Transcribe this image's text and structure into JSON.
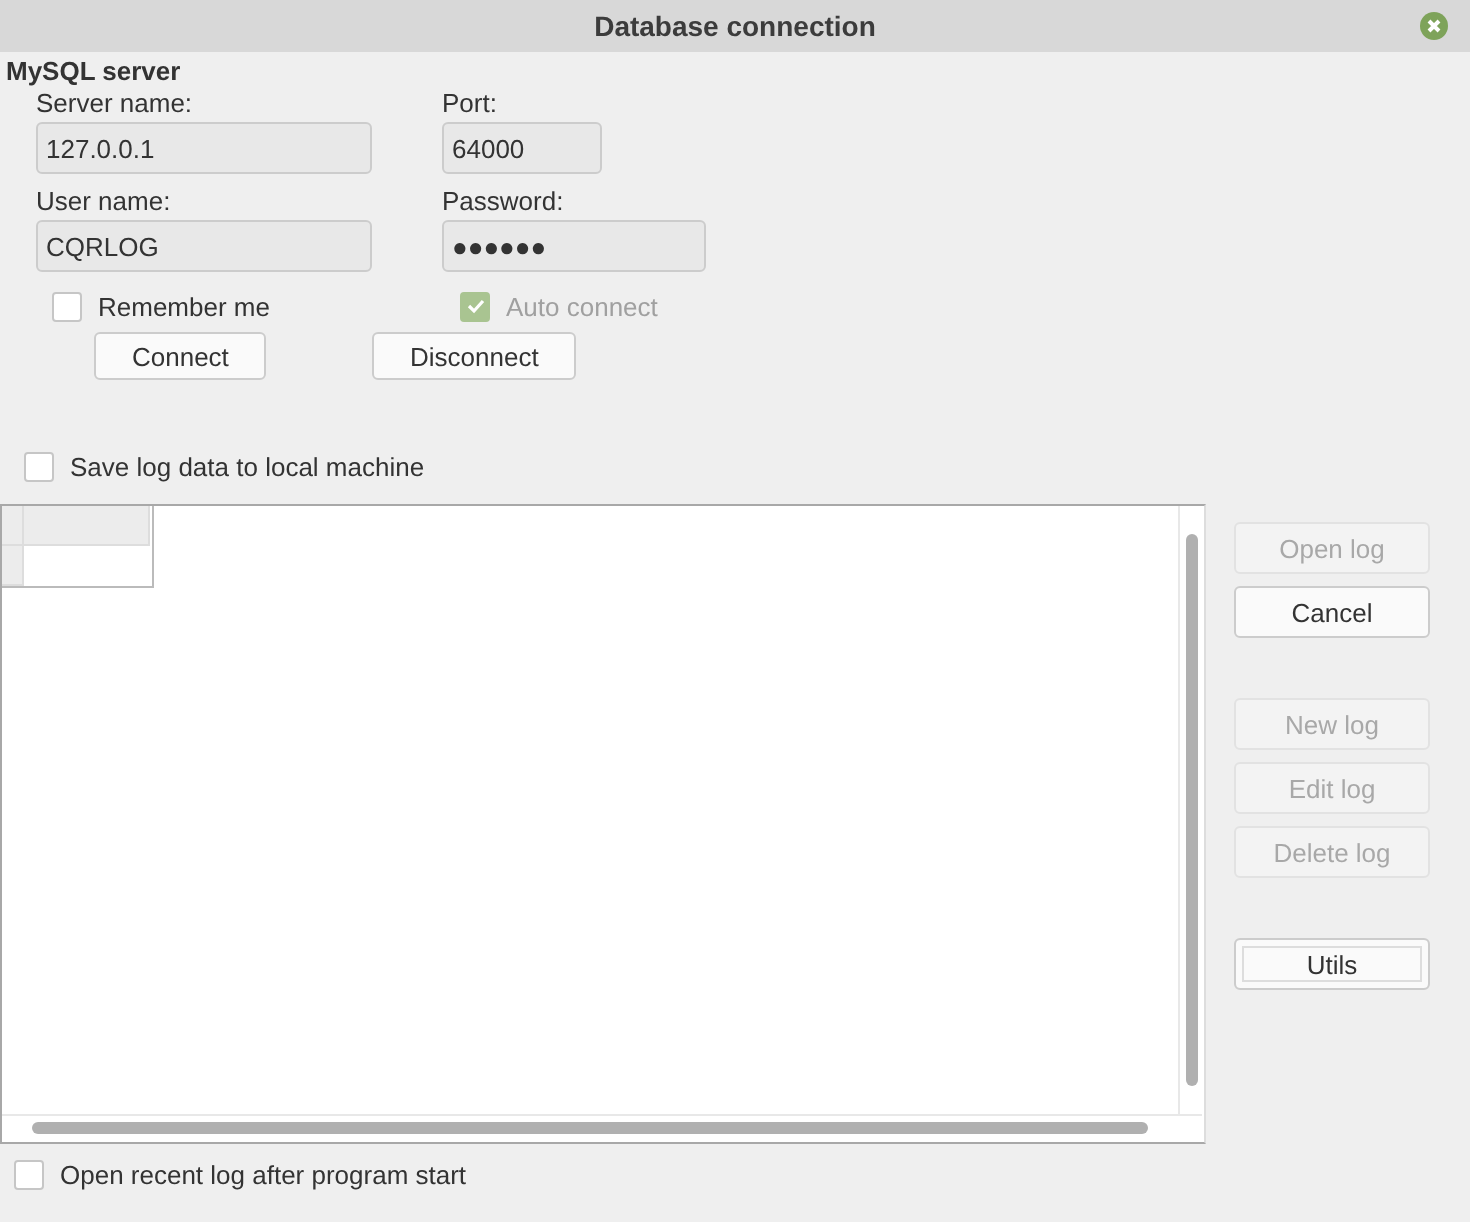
{
  "window": {
    "title": "Database connection"
  },
  "mysql_server": {
    "heading": "MySQL server",
    "fields": [
      {
        "label": "Server name:",
        "value": "127.0.0.1",
        "kind": "wide"
      },
      {
        "label": "Port:",
        "value": "64000",
        "kind": "narrow"
      },
      {
        "label": "User name:",
        "value": "CQRLOG",
        "kind": "wide"
      },
      {
        "label": "Password:",
        "value": "●●●●●●",
        "kind": "medium"
      }
    ],
    "checkboxes": [
      {
        "label": "Remember me",
        "checked": false,
        "disabled": false
      },
      {
        "label": "Auto connect",
        "checked": true,
        "disabled": true
      }
    ],
    "buttons": [
      {
        "label": "Connect",
        "disabled": false
      },
      {
        "label": "Disconnect",
        "disabled": false
      }
    ]
  },
  "save_local": {
    "label": "Save log data to local machine",
    "checked": false
  },
  "side_button_groups": [
    [
      {
        "label": "Open log",
        "disabled": true,
        "focused": false
      },
      {
        "label": "Cancel",
        "disabled": false,
        "focused": false
      }
    ],
    [
      {
        "label": "New log",
        "disabled": true,
        "focused": false
      },
      {
        "label": "Edit log",
        "disabled": true,
        "focused": false
      },
      {
        "label": "Delete log",
        "disabled": true,
        "focused": false
      }
    ],
    [
      {
        "label": "Utils",
        "disabled": false,
        "focused": true
      }
    ]
  ],
  "open_recent": {
    "label": "Open recent log after program start",
    "checked": false
  }
}
